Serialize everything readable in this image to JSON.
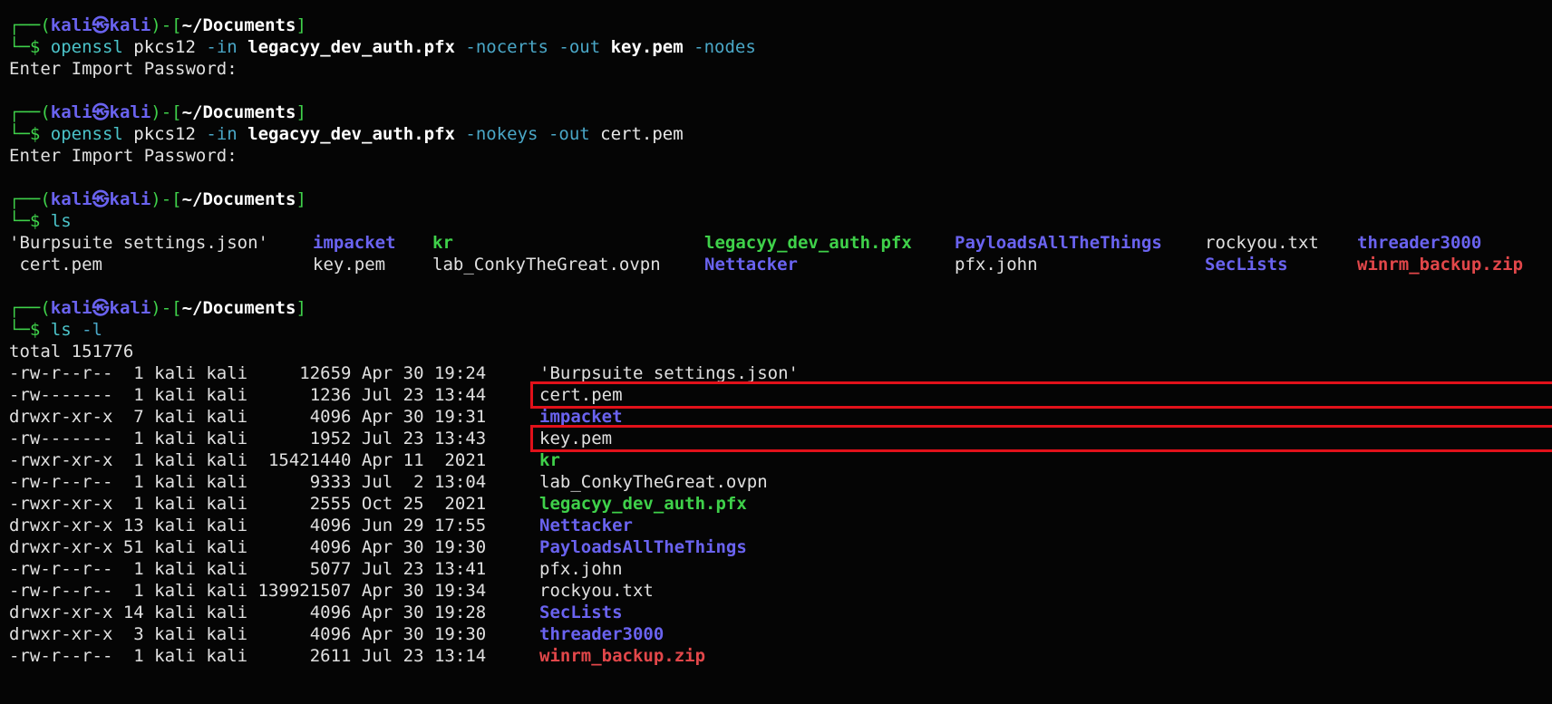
{
  "prompt": {
    "user": "kali",
    "host": "kali",
    "skull": "㉿",
    "cwd": "~/Documents"
  },
  "sessions": [
    {
      "cmd": "openssl",
      "args": [
        {
          "t": "pkcs12",
          "c": "arg"
        },
        {
          "t": "-in",
          "c": "opt"
        },
        {
          "t": "legacyy_dev_auth.pfx",
          "c": "argb"
        },
        {
          "t": "-nocerts",
          "c": "opt"
        },
        {
          "t": "-out",
          "c": "opt"
        },
        {
          "t": "key.pem",
          "c": "argb"
        },
        {
          "t": "-nodes",
          "c": "opt"
        }
      ],
      "output": [
        "Enter Import Password:"
      ]
    },
    {
      "cmd": "openssl",
      "args": [
        {
          "t": "pkcs12",
          "c": "arg"
        },
        {
          "t": "-in",
          "c": "opt"
        },
        {
          "t": "legacyy_dev_auth.pfx",
          "c": "argb"
        },
        {
          "t": "-nokeys",
          "c": "opt"
        },
        {
          "t": "-out",
          "c": "opt"
        },
        {
          "t": "cert.pem",
          "c": "arg"
        }
      ],
      "output": [
        "Enter Import Password:"
      ]
    }
  ],
  "ls_cmd": "ls",
  "ls_rows": [
    [
      {
        "t": "'Burpsuite settings.json'",
        "c": "plain"
      },
      {
        "t": "impacket",
        "c": "dir"
      },
      {
        "t": "kr",
        "c": "exe"
      },
      {
        "t": "legacyy_dev_auth.pfx",
        "c": "exe"
      },
      {
        "t": "PayloadsAllTheThings",
        "c": "dir"
      },
      {
        "t": "rockyou.txt",
        "c": "plain"
      },
      {
        "t": "threader3000",
        "c": "dir"
      }
    ],
    [
      {
        "t": " cert.pem",
        "c": "plain"
      },
      {
        "t": "key.pem",
        "c": "plain"
      },
      {
        "t": "lab_ConkyTheGreat.ovpn",
        "c": "plain"
      },
      {
        "t": "Nettacker",
        "c": "dir"
      },
      {
        "t": "pfx.john",
        "c": "plain"
      },
      {
        "t": "SecLists",
        "c": "dir"
      },
      {
        "t": "winrm_backup.zip",
        "c": "zip"
      }
    ]
  ],
  "lsl_cmd": "ls -l",
  "lsl_total": "total 151776",
  "lsl_rows": [
    {
      "meta": "-rw-r--r--  1 kali kali     12659 Apr 30 19:24",
      "name": "'Burpsuite settings.json'",
      "c": "plain",
      "hl": false
    },
    {
      "meta": "-rw-------  1 kali kali      1236 Jul 23 13:44",
      "name": "cert.pem",
      "c": "plain",
      "hl": true
    },
    {
      "meta": "drwxr-xr-x  7 kali kali      4096 Apr 30 19:31",
      "name": "impacket",
      "c": "dir",
      "hl": false
    },
    {
      "meta": "-rw-------  1 kali kali      1952 Jul 23 13:43",
      "name": "key.pem",
      "c": "plain",
      "hl": true
    },
    {
      "meta": "-rwxr-xr-x  1 kali kali  15421440 Apr 11  2021",
      "name": "kr",
      "c": "exe",
      "hl": false
    },
    {
      "meta": "-rw-r--r--  1 kali kali      9333 Jul  2 13:04",
      "name": "lab_ConkyTheGreat.ovpn",
      "c": "plain",
      "hl": false
    },
    {
      "meta": "-rwxr-xr-x  1 kali kali      2555 Oct 25  2021",
      "name": "legacyy_dev_auth.pfx",
      "c": "exe",
      "hl": false
    },
    {
      "meta": "drwxr-xr-x 13 kali kali      4096 Jun 29 17:55",
      "name": "Nettacker",
      "c": "dir",
      "hl": false
    },
    {
      "meta": "drwxr-xr-x 51 kali kali      4096 Apr 30 19:30",
      "name": "PayloadsAllTheThings",
      "c": "dir",
      "hl": false
    },
    {
      "meta": "-rw-r--r--  1 kali kali      5077 Jul 23 13:41",
      "name": "pfx.john",
      "c": "plain",
      "hl": false
    },
    {
      "meta": "-rw-r--r--  1 kali kali 139921507 Apr 30 19:34",
      "name": "rockyou.txt",
      "c": "plain",
      "hl": false
    },
    {
      "meta": "drwxr-xr-x 14 kali kali      4096 Apr 30 19:28",
      "name": "SecLists",
      "c": "dir",
      "hl": false
    },
    {
      "meta": "drwxr-xr-x  3 kali kali      4096 Apr 30 19:30",
      "name": "threader3000",
      "c": "dir",
      "hl": false
    },
    {
      "meta": "-rw-r--r--  1 kali kali      2611 Jul 23 13:14",
      "name": "winrm_backup.zip",
      "c": "zip",
      "hl": false
    }
  ]
}
